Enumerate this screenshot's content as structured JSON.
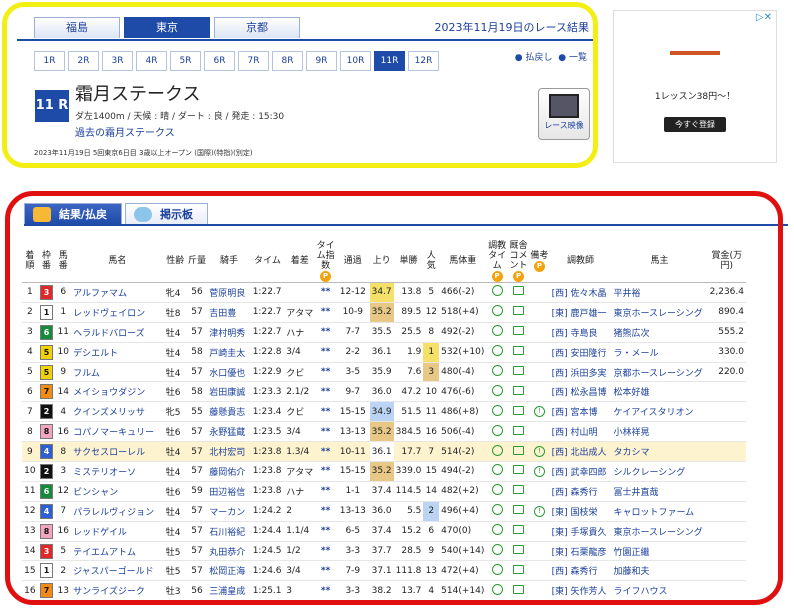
{
  "venues": [
    "福島",
    "東京",
    "京都"
  ],
  "active_venue": 1,
  "race_date_text": "2023年11月19日のレース結果",
  "race_numbers": [
    "1R",
    "2R",
    "3R",
    "4R",
    "5R",
    "6R",
    "7R",
    "8R",
    "9R",
    "10R",
    "11R",
    "12R"
  ],
  "active_race": 10,
  "links": {
    "payback": "払戻し",
    "list": "一覧"
  },
  "race": {
    "badge": "11 R",
    "name": "霜月ステークス",
    "conditions": "ダ左1400m / 天候 : 晴 / ダート : 良 / 発走 : 15:30",
    "past_link": "過去の霜月ステークス",
    "info": "2023年11月19日 5回東京6日目 3歳以上オープン (国際)(特指)(別定)",
    "video_label": "レース映像"
  },
  "ad": {
    "text": "1レッスン38円～！",
    "button": "今すぐ登録",
    "close": "▷✕"
  },
  "tabs": [
    "結果/払戻",
    "掲示板"
  ],
  "headers": {
    "rank": "着順",
    "waku": "枠番",
    "num": "馬番",
    "horse": "馬名",
    "sexage": "性齢",
    "weight": "斤量",
    "jockey": "騎手",
    "time": "タイム",
    "margin": "着差",
    "index": "タイム指数",
    "pass": "通過",
    "agari": "上り",
    "odds": "単勝",
    "pop": "人気",
    "bw": "馬体重",
    "train": "調教タイム",
    "comment": "厩舎コメント",
    "note": "備考",
    "trainer": "調教師",
    "owner": "馬主",
    "prize": "賞金(万円)"
  },
  "rows": [
    {
      "rank": "1",
      "waku": "3",
      "num": "6",
      "horse": "アルファマム",
      "sexage": "牝4",
      "weight": "56",
      "jockey": "菅原明良",
      "time": "1:22.7",
      "margin": "",
      "index": "**",
      "pass": "12-12",
      "agari": "34.7",
      "odds": "13.8",
      "pop": "5",
      "bw": "466(-2)",
      "note": false,
      "trainer": "[西] 佐々木晶",
      "owner": "平井裕",
      "prize": "2,236.4"
    },
    {
      "rank": "2",
      "waku": "1",
      "num": "1",
      "horse": "レッドヴェイロン",
      "sexage": "牡8",
      "weight": "57",
      "jockey": "吉田豊",
      "time": "1:22.7",
      "margin": "アタマ",
      "index": "**",
      "pass": "10-9",
      "agari": "35.2",
      "odds": "89.5",
      "pop": "12",
      "bw": "518(+4)",
      "note": false,
      "trainer": "[東] 鹿戸雄一",
      "owner": "東京ホースレーシング",
      "prize": "890.4"
    },
    {
      "rank": "3",
      "waku": "6",
      "num": "11",
      "horse": "ヘラルドバローズ",
      "sexage": "牡4",
      "weight": "57",
      "jockey": "津村明秀",
      "time": "1:22.7",
      "margin": "ハナ",
      "index": "**",
      "pass": "7-7",
      "agari": "35.5",
      "odds": "25.5",
      "pop": "8",
      "bw": "492(-2)",
      "note": false,
      "trainer": "[西] 寺島良",
      "owner": "猪熊広次",
      "prize": "555.2"
    },
    {
      "rank": "4",
      "waku": "5",
      "num": "10",
      "horse": "デシエルト",
      "sexage": "牡4",
      "weight": "58",
      "jockey": "戸崎圭太",
      "time": "1:22.8",
      "margin": "3/4",
      "index": "**",
      "pass": "2-2",
      "agari": "36.1",
      "odds": "1.9",
      "pop": "1",
      "bw": "532(+10)",
      "note": false,
      "trainer": "[西] 安田隆行",
      "owner": "ラ・メール",
      "prize": "330.0"
    },
    {
      "rank": "5",
      "waku": "5",
      "num": "9",
      "horse": "フルム",
      "sexage": "牡4",
      "weight": "57",
      "jockey": "水口優也",
      "time": "1:22.9",
      "margin": "クビ",
      "index": "**",
      "pass": "3-5",
      "agari": "35.9",
      "odds": "7.6",
      "pop": "3",
      "bw": "480(-4)",
      "note": false,
      "trainer": "[西] 浜田多実",
      "owner": "京都ホースレーシング",
      "prize": "220.0"
    },
    {
      "rank": "6",
      "waku": "7",
      "num": "14",
      "horse": "メイショウダジン",
      "sexage": "牡6",
      "weight": "58",
      "jockey": "岩田康誠",
      "time": "1:23.3",
      "margin": "2.1/2",
      "index": "**",
      "pass": "9-7",
      "agari": "36.0",
      "odds": "47.2",
      "pop": "10",
      "bw": "476(-6)",
      "note": false,
      "trainer": "[西] 松永昌博",
      "owner": "松本好雄",
      "prize": ""
    },
    {
      "rank": "7",
      "waku": "2",
      "num": "4",
      "horse": "クインズメリッサ",
      "sexage": "牝5",
      "weight": "55",
      "jockey": "藤懸貴志",
      "time": "1:23.4",
      "margin": "クビ",
      "index": "**",
      "pass": "15-15",
      "agari": "34.9",
      "odds": "51.5",
      "pop": "11",
      "bw": "486(+8)",
      "note": true,
      "trainer": "[西] 宮本博",
      "owner": "ケイアイスタリオン",
      "prize": ""
    },
    {
      "rank": "8",
      "waku": "8",
      "num": "16",
      "horse": "コパノマーキュリー",
      "sexage": "牡6",
      "weight": "57",
      "jockey": "永野猛蔵",
      "time": "1:23.5",
      "margin": "3/4",
      "index": "**",
      "pass": "13-13",
      "agari": "35.2",
      "odds": "384.5",
      "pop": "16",
      "bw": "506(-4)",
      "note": false,
      "trainer": "[西] 村山明",
      "owner": "小林祥晃",
      "prize": ""
    },
    {
      "rank": "9",
      "waku": "4",
      "num": "8",
      "horse": "サクセスローレル",
      "sexage": "牡4",
      "weight": "57",
      "jockey": "北村宏司",
      "time": "1:23.8",
      "margin": "1.3/4",
      "index": "**",
      "pass": "10-11",
      "agari": "36.1",
      "odds": "17.7",
      "pop": "7",
      "bw": "514(-2)",
      "note": true,
      "trainer": "[西] 北出成人",
      "owner": "タカシマ",
      "prize": ""
    },
    {
      "rank": "10",
      "waku": "2",
      "num": "3",
      "horse": "ミステリオーソ",
      "sexage": "牡4",
      "weight": "57",
      "jockey": "藤岡佑介",
      "time": "1:23.8",
      "margin": "アタマ",
      "index": "**",
      "pass": "15-15",
      "agari": "35.2",
      "odds": "339.0",
      "pop": "15",
      "bw": "494(-2)",
      "note": true,
      "trainer": "[西] 武幸四郎",
      "owner": "シルクレーシング",
      "prize": ""
    },
    {
      "rank": "11",
      "waku": "6",
      "num": "12",
      "horse": "ビンシャン",
      "sexage": "牡6",
      "weight": "59",
      "jockey": "田辺裕信",
      "time": "1:23.8",
      "margin": "ハナ",
      "index": "**",
      "pass": "1-1",
      "agari": "37.4",
      "odds": "114.5",
      "pop": "14",
      "bw": "482(+2)",
      "note": false,
      "trainer": "[西] 森秀行",
      "owner": "冨士井直哉",
      "prize": ""
    },
    {
      "rank": "12",
      "waku": "4",
      "num": "7",
      "horse": "パラレルヴィジョン",
      "sexage": "牡4",
      "weight": "57",
      "jockey": "マーカン",
      "time": "1:24.2",
      "margin": "2",
      "index": "**",
      "pass": "13-13",
      "agari": "36.0",
      "odds": "5.5",
      "pop": "2",
      "bw": "496(+4)",
      "note": true,
      "trainer": "[東] 国枝栄",
      "owner": "キャロットファーム",
      "prize": ""
    },
    {
      "rank": "13",
      "waku": "8",
      "num": "16",
      "horse": "レッドゲイル",
      "sexage": "牡4",
      "weight": "57",
      "jockey": "石川裕紀",
      "time": "1:24.4",
      "margin": "1.1/4",
      "index": "**",
      "pass": "6-5",
      "agari": "37.4",
      "odds": "15.2",
      "pop": "6",
      "bw": "470(0)",
      "note": false,
      "trainer": "[東] 手塚貴久",
      "owner": "東京ホースレーシング",
      "prize": ""
    },
    {
      "rank": "14",
      "waku": "3",
      "num": "5",
      "horse": "テイエムアトム",
      "sexage": "牡5",
      "weight": "57",
      "jockey": "丸田恭介",
      "time": "1:24.5",
      "margin": "1/2",
      "index": "**",
      "pass": "3-3",
      "agari": "37.7",
      "odds": "28.5",
      "pop": "9",
      "bw": "540(+14)",
      "note": false,
      "trainer": "[東] 石栗龍彦",
      "owner": "竹園正繼",
      "prize": ""
    },
    {
      "rank": "15",
      "waku": "1",
      "num": "2",
      "horse": "ジャスパーゴールド",
      "sexage": "牡5",
      "weight": "57",
      "jockey": "松岡正海",
      "time": "1:24.6",
      "margin": "3/4",
      "index": "**",
      "pass": "7-9",
      "agari": "37.1",
      "odds": "111.8",
      "pop": "13",
      "bw": "472(+4)",
      "note": false,
      "trainer": "[西] 森秀行",
      "owner": "加藤和夫",
      "prize": ""
    },
    {
      "rank": "16",
      "waku": "7",
      "num": "13",
      "horse": "サンライズジーク",
      "sexage": "牡3",
      "weight": "56",
      "jockey": "三浦皇成",
      "time": "1:25.1",
      "margin": "3",
      "index": "**",
      "pass": "3-3",
      "agari": "38.2",
      "odds": "13.7",
      "pop": "4",
      "bw": "514(+14)",
      "note": false,
      "trainer": "[東] 矢作芳人",
      "owner": "ライフハウス",
      "prize": ""
    }
  ],
  "waku_colors": {
    "1": "#ffffff",
    "2": "#111111",
    "3": "#e0282a",
    "4": "#2c5fd4",
    "5": "#f1d20a",
    "6": "#17893a",
    "7": "#f08c15",
    "8": "#f2a6be"
  }
}
